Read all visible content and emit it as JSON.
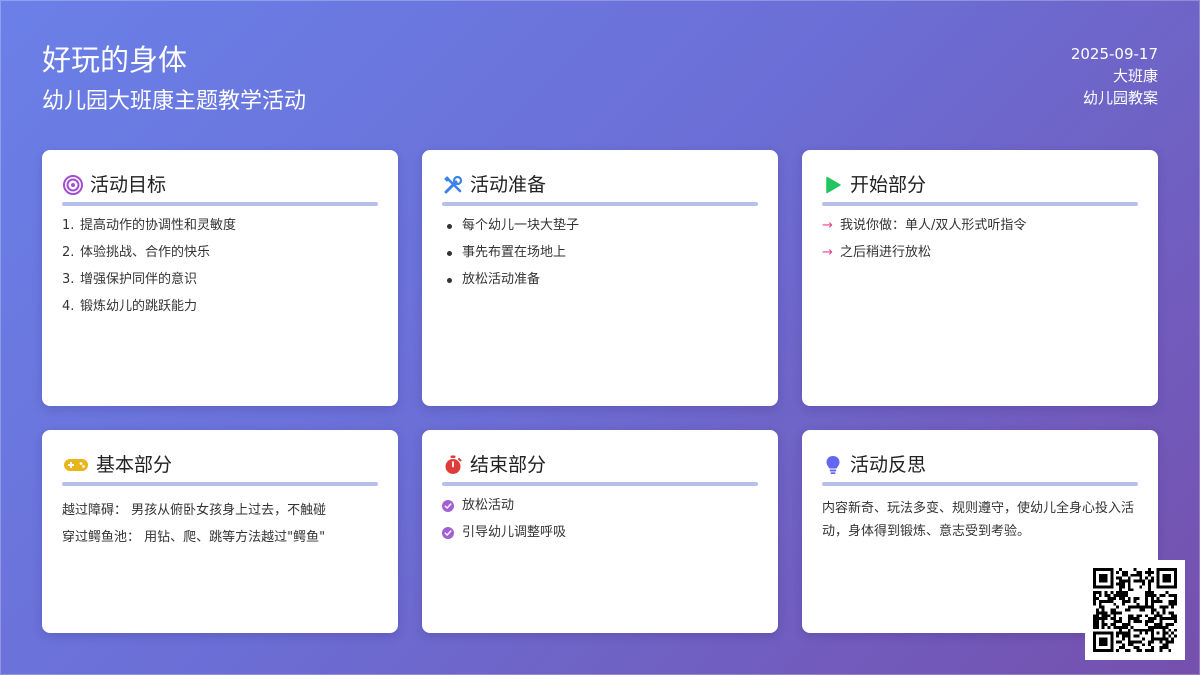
{
  "header": {
    "title": "好玩的身体",
    "subtitle": "幼儿园大班康主题教学活动",
    "date": "2025-09-17",
    "class_name": "大班康",
    "doc_type": "幼儿园教案"
  },
  "cards": {
    "goals": {
      "title": "活动目标",
      "icon": "target-icon",
      "items": [
        "提高动作的协调性和灵敏度",
        "体验挑战、合作的快乐",
        "增强保护同伴的意识",
        "锻炼幼儿的跳跃能力"
      ]
    },
    "prep": {
      "title": "活动准备",
      "icon": "tools-icon",
      "items": [
        "每个幼儿一块大垫子",
        "事先布置在场地上",
        "放松活动准备"
      ]
    },
    "start": {
      "title": "开始部分",
      "icon": "play-icon",
      "items": [
        "我说你做：单人/双人形式听指令",
        "之后稍进行放松"
      ]
    },
    "basic": {
      "title": "基本部分",
      "icon": "gamepad-icon",
      "lines": [
        "越过障碍： 男孩从俯卧女孩身上过去，不触碰",
        "穿过鳄鱼池： 用钻、爬、跳等方法越过\"鳄鱼\""
      ]
    },
    "end": {
      "title": "结束部分",
      "icon": "stopwatch-icon",
      "items": [
        "放松活动",
        "引导幼儿调整呼吸"
      ]
    },
    "reflect": {
      "title": "活动反思",
      "icon": "lightbulb-icon",
      "text": "内容新奇、玩法多变、规则遵守，使幼儿全身心投入活动，身体得到锻炼、意志受到考验。"
    }
  },
  "colors": {
    "rule": "#b8bfe8",
    "target": "#a24fd0",
    "tools": "#3b82e6",
    "play": "#22c55e",
    "gamepad": "#e8b51a",
    "stopwatch": "#e03a3a",
    "lightbulb": "#6366f1",
    "arrow": "#e0468f",
    "check": "#a55fd4"
  },
  "qr_code": {
    "icon": "qr-code-icon"
  }
}
